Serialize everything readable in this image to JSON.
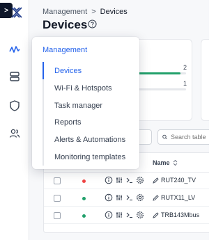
{
  "breadcrumb": {
    "parent": "Management",
    "separator": ">",
    "current": "Devices"
  },
  "page": {
    "title": "Devices"
  },
  "rail": {
    "icons": [
      "collapse-icon",
      "logo",
      "activity-icon",
      "server-icon",
      "shield-icon",
      "users-icon"
    ],
    "collapse_glyph": ">"
  },
  "stats": {
    "value_1": "2",
    "value_2": "1",
    "bar_1_fill": 0.9,
    "bar_2_fill": 0.35,
    "colors": {
      "bar": "#22a06b"
    }
  },
  "toolbar": {
    "filter_label": "er",
    "search_placeholder": "Search table"
  },
  "table": {
    "columns": {
      "name": "Name"
    },
    "rows": [
      {
        "status": "offline",
        "status_color": "#ef4444",
        "name": "RUT240_TV"
      },
      {
        "status": "online",
        "status_color": "#22a06b",
        "name": "RUTX11_LV"
      },
      {
        "status": "online",
        "status_color": "#22a06b",
        "name": "TRB143Mbus"
      }
    ]
  },
  "menu": {
    "title": "Management",
    "items": [
      {
        "label": "Devices",
        "active": true
      },
      {
        "label": "Wi-Fi & Hotspots",
        "active": false
      },
      {
        "label": "Task manager",
        "active": false
      },
      {
        "label": "Reports",
        "active": false
      },
      {
        "label": "Alerts & Automations",
        "active": false
      },
      {
        "label": "Monitoring templates",
        "active": false
      }
    ]
  },
  "colors": {
    "accent": "#2563eb",
    "rail_dark": "#0f172a"
  }
}
